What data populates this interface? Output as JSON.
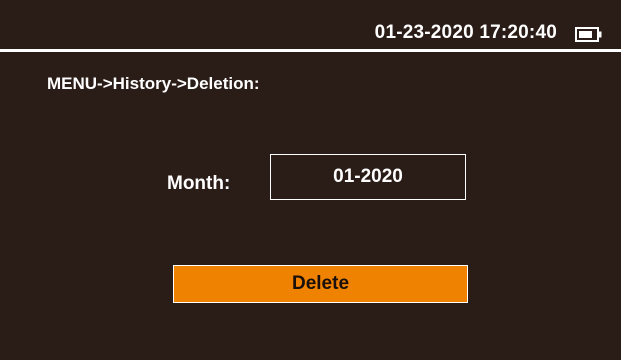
{
  "status_bar": {
    "datetime": "01-23-2020 17:20:40",
    "battery_icon": "battery-icon"
  },
  "breadcrumb": "MENU->History->Deletion:",
  "month": {
    "label": "Month:",
    "value": "01-2020"
  },
  "delete_button": {
    "label": "Delete"
  },
  "colors": {
    "background": "#2a1c17",
    "accent": "#ef8200",
    "text": "#ffffff"
  }
}
